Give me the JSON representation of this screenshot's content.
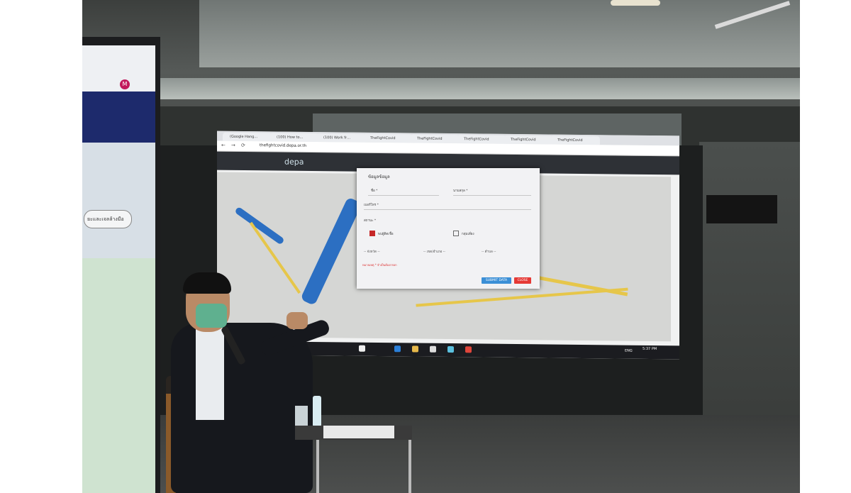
{
  "browser": {
    "tabs": [
      "(Google Hang…",
      "(100) How to…",
      "(100) Work fr…",
      "TheFightCovid",
      "TheFightCovid",
      "TheFightCovid",
      "TheFightCovid",
      "TheFightCovid"
    ],
    "url": "thefightcovid.depa.or.th"
  },
  "app": {
    "logo": "depa"
  },
  "dialog": {
    "title": "ข้อมูลข้อมูล",
    "labels": [
      "ชื่อ *",
      "นามสกุล *",
      "เบอร์โทร *",
      "สถานะ *"
    ],
    "checkbox_1": "พบผู้ติดเชื้อ",
    "checkbox_2": "กลุ่มเสี่ยง",
    "selects": [
      "-- จังหวัด --",
      "-- เขต/อำเภอ --",
      "-- ตำบล --"
    ],
    "note": "หมายเหตุ * จำเป็นต้องกรอก",
    "submit": "SUBMIT DATA",
    "close": "CLOSE"
  },
  "tablet": {
    "avatar_initial": "M",
    "pill_text": "ยะและเจลล้างมือ"
  },
  "taskbar": {
    "time": "5:37 PM",
    "lang": "ENG"
  }
}
